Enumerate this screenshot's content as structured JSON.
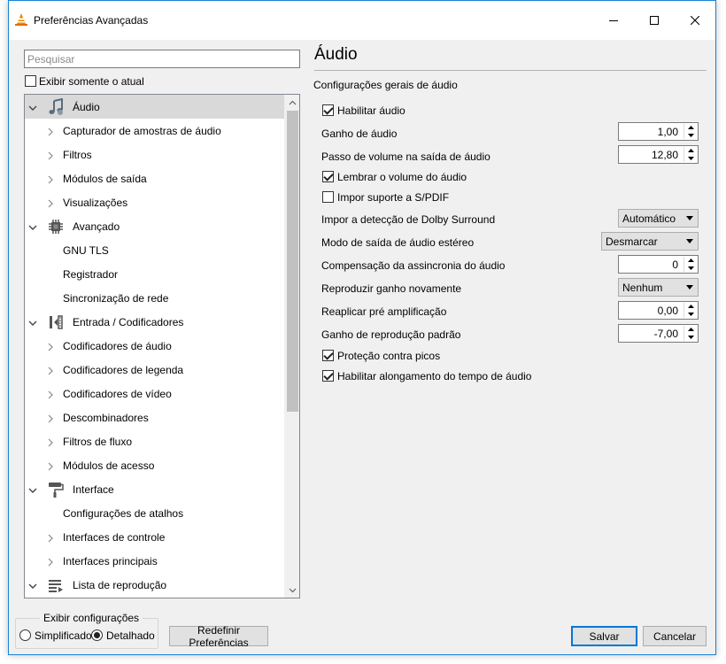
{
  "window": {
    "title": "Preferências Avançadas",
    "controls": {
      "minimize": "minimize-icon",
      "maximize": "maximize-icon",
      "close": "close-icon"
    }
  },
  "search": {
    "placeholder": "Pesquisar"
  },
  "show_current_only": {
    "label": "Exibir somente o atual",
    "checked": false
  },
  "tree": [
    {
      "label": "Áudio",
      "level": 0,
      "icon": "audio-note-icon",
      "expanded": true,
      "selected": true
    },
    {
      "label": "Capturador de amostras de áudio",
      "level": 1,
      "has_children": true
    },
    {
      "label": "Filtros",
      "level": 1,
      "has_children": true
    },
    {
      "label": "Módulos de saída",
      "level": 1,
      "has_children": true
    },
    {
      "label": "Visualizações",
      "level": 1,
      "has_children": true
    },
    {
      "label": "Avançado",
      "level": 0,
      "icon": "chip-icon",
      "expanded": true
    },
    {
      "label": "GNU TLS",
      "level": 1,
      "has_children": false
    },
    {
      "label": "Registrador",
      "level": 1,
      "has_children": false
    },
    {
      "label": "Sincronização de rede",
      "level": 1,
      "has_children": false
    },
    {
      "label": "Entrada / Codificadores",
      "level": 0,
      "icon": "input-codec-icon",
      "expanded": true
    },
    {
      "label": "Codificadores de áudio",
      "level": 1,
      "has_children": true
    },
    {
      "label": "Codificadores de legenda",
      "level": 1,
      "has_children": true
    },
    {
      "label": "Codificadores de vídeo",
      "level": 1,
      "has_children": true
    },
    {
      "label": "Descombinadores",
      "level": 1,
      "has_children": true
    },
    {
      "label": "Filtros de fluxo",
      "level": 1,
      "has_children": true
    },
    {
      "label": "Módulos de acesso",
      "level": 1,
      "has_children": true
    },
    {
      "label": "Interface",
      "level": 0,
      "icon": "paint-roller-icon",
      "expanded": true
    },
    {
      "label": "Configurações de atalhos",
      "level": 1,
      "has_children": false
    },
    {
      "label": "Interfaces de controle",
      "level": 1,
      "has_children": true
    },
    {
      "label": "Interfaces principais",
      "level": 1,
      "has_children": true
    },
    {
      "label": "Lista de reprodução",
      "level": 0,
      "icon": "playlist-icon",
      "expanded": true
    }
  ],
  "show_settings": {
    "title": "Exibir configurações",
    "simple": "Simplificado",
    "detailed": "Detalhado",
    "selected": "Detalhado"
  },
  "buttons": {
    "reset": "Redefinir Preferências",
    "save": "Salvar",
    "cancel": "Cancelar"
  },
  "panel": {
    "title": "Áudio",
    "subtitle": "Configurações gerais de áudio",
    "enable_audio": {
      "label": "Habilitar áudio",
      "checked": true
    },
    "gain": {
      "label": "Ganho de áudio",
      "value": "1,00"
    },
    "volume_step": {
      "label": "Passo de volume na saída de áudio",
      "value": "12,80"
    },
    "remember_volume": {
      "label": "Lembrar o volume do áudio",
      "checked": true
    },
    "force_spdif": {
      "label": "Impor suporte a S/PDIF",
      "checked": false
    },
    "dolby": {
      "label": "Impor a detecção de Dolby Surround",
      "value": "Automático"
    },
    "stereo_mode": {
      "label": "Modo de saída de áudio estéreo",
      "value": "Desmarcar"
    },
    "desync": {
      "label": "Compensação da assincronia do áudio",
      "value": "0"
    },
    "replay_gain": {
      "label": "Reproduzir ganho novamente",
      "value": "Nenhum"
    },
    "preamp": {
      "label": "Reaplicar pré amplificação",
      "value": "0,00"
    },
    "default_gain": {
      "label": "Ganho de reprodução padrão",
      "value": "-7,00"
    },
    "peak_protection": {
      "label": "Proteção contra picos",
      "checked": true
    },
    "time_stretch": {
      "label": "Habilitar alongamento do tempo de áudio",
      "checked": true
    }
  },
  "colors": {
    "accent": "#0078d7",
    "selection": "#d9d9d9",
    "window_bg": "#f0f0f0",
    "vlc_orange": "#f08a00"
  }
}
